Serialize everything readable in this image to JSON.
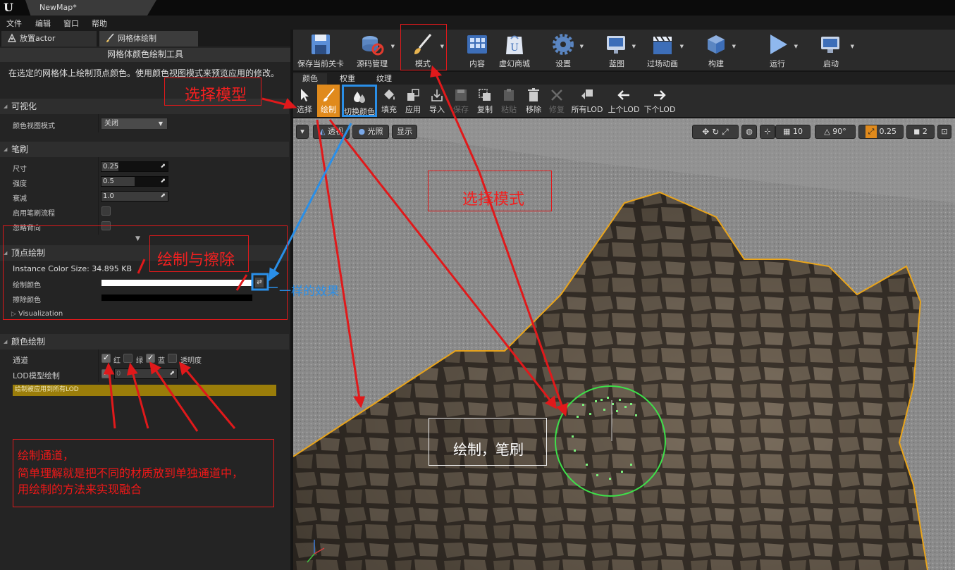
{
  "window": {
    "doc_tab": "NewMap*"
  },
  "menu": [
    "文件",
    "编辑",
    "窗口",
    "帮助"
  ],
  "mode_tabs": {
    "place_actor": "放置actor",
    "mesh_paint": "网格体绘制"
  },
  "tool": {
    "header": "网格体颜色绘制工具",
    "description": "在选定的网格体上绘制顶点颜色。使用颜色视图模式来预览应用的修改。"
  },
  "visualize": {
    "section": "可视化",
    "color_view_mode_label": "颜色视图模式",
    "color_view_mode_value": "关闭"
  },
  "brush": {
    "section": "笔刷",
    "size_label": "尺寸",
    "size_value": "0.25",
    "strength_label": "强度",
    "strength_value": "0.5",
    "falloff_label": "衰减",
    "falloff_value": "1.0",
    "flow_label": "启用笔刷流程",
    "backface_label": "忽略背向"
  },
  "vertex_paint": {
    "section": "顶点绘制",
    "instance_size": "Instance Color Size: 34.895 KB",
    "paint_color_label": "绘制颜色",
    "erase_color_label": "擦除颜色",
    "visualization_label": "Visualization"
  },
  "color_paint": {
    "section": "颜色绘制",
    "channel_label": "通道",
    "channels": [
      "红",
      "绿",
      "蓝",
      "透明度"
    ],
    "channel_states": [
      true,
      false,
      true,
      false
    ],
    "lod_label": "LOD模型绘制",
    "lod_value": "0",
    "lod_warning": "绘制被应用到所有LOD"
  },
  "toolbar": [
    "保存当前关卡",
    "源码管理",
    "模式",
    "内容",
    "虚幻商城",
    "设置",
    "蓝图",
    "过场动画",
    "构建",
    "运行",
    "启动"
  ],
  "sub_tabs": [
    "颜色",
    "权重",
    "纹理"
  ],
  "paint_tools": [
    "选择",
    "绘制",
    "切换颜色",
    "填充",
    "应用",
    "导入",
    "保存",
    "复制",
    "粘贴",
    "移除",
    "修复",
    "所有LOD",
    "上个LOD",
    "下个LOD"
  ],
  "viewport": {
    "perspective": "透视",
    "lit": "光照",
    "show": "显示",
    "grid_value": "10",
    "angle_value": "90°",
    "scale_value": "0.25",
    "camera_speed": "2"
  },
  "annotations": {
    "select_model": "选择模型",
    "select_mode": "选择模式",
    "paint_erase": "绘制与擦除",
    "same_effect": "一样的效果",
    "paint_brush": "绘制，笔刷",
    "channel_note": [
      "绘制通道，",
      "简单理解就是把不同的材质放到单独通道中，",
      "用绘制的方法来实现融合"
    ]
  },
  "colors": {
    "accent_orange": "#e08a1c",
    "highlight_blue": "#2a8fe8",
    "annotation_red": "#e0191b",
    "brush_green": "#3ee04a"
  }
}
